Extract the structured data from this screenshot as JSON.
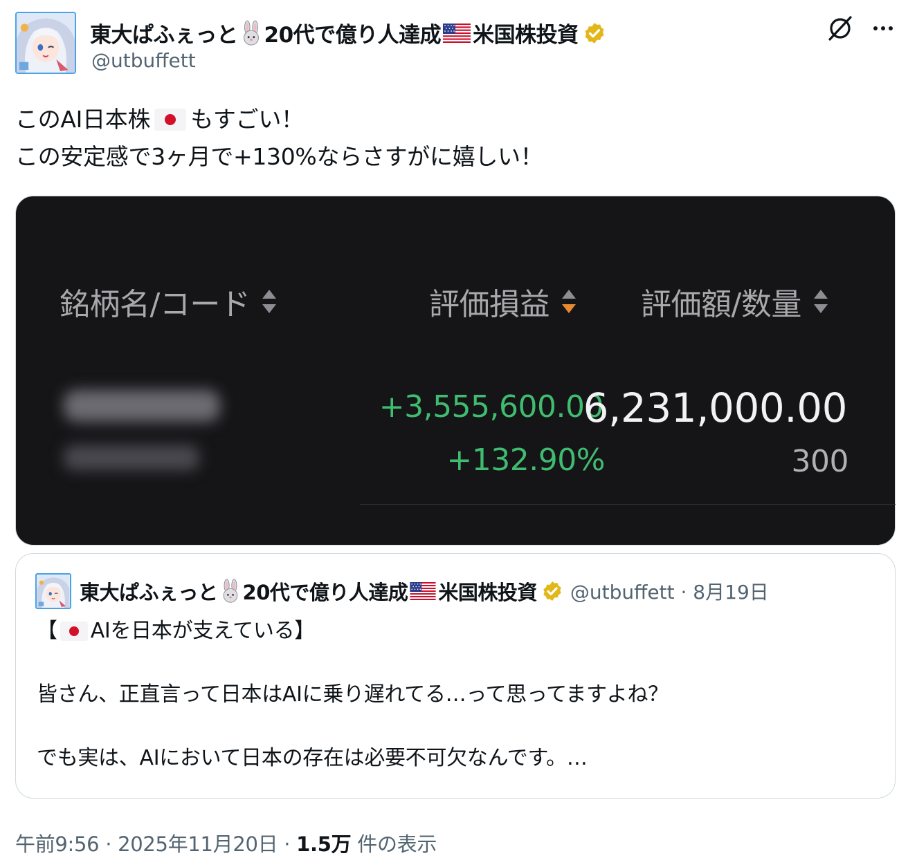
{
  "author": {
    "name_part1": "東大ぱふぇっと",
    "name_part2": "20代で億り人達成",
    "name_part3": "米国株投資",
    "handle": "@utbuffett"
  },
  "tweet": {
    "line1_before": "このAI日本株",
    "line1_after": "もすごい！",
    "line2": "この安定感で3ヶ月で+130%ならさすがに嬉しい！"
  },
  "media": {
    "col_name": "銘柄名/コード",
    "col_pl": "評価損益",
    "col_value": "評価額/数量",
    "pl_amount": "+3,555,600.00",
    "pl_percent": "+132.90%",
    "value_amount": "6,231,000.00",
    "quantity": "300"
  },
  "quote": {
    "name_part1": "東大ぱふぇっと",
    "name_part2": "20代で億り人達成",
    "name_part3": "米国株投資",
    "meta": "@utbuffett · 8月19日",
    "title_open": "【",
    "title_text": "AIを日本が支えている】",
    "para1": "皆さん、正直言って日本はAIに乗り遅れてる…って思ってますよね？",
    "para2": "でも実は、AIにおいて日本の存在は必要不可欠なんです。…"
  },
  "footer": {
    "time": "午前9:56 · 2025年11月20日 · ",
    "views": "1.5万",
    "views_label": " 件の表示"
  },
  "icons": {
    "rabbit": "rabbit-emoji",
    "us_flag": "us-flag-emoji",
    "jp_flag": "jp-flag-emoji",
    "verified": "verified-badge-icon",
    "grok": "grok-icon",
    "more": "more-icon"
  },
  "colors": {
    "verified_gold": "#e2b719",
    "gain_green": "#3fbc6f",
    "sort_active": "#e8892f",
    "media_bg": "#151518"
  }
}
